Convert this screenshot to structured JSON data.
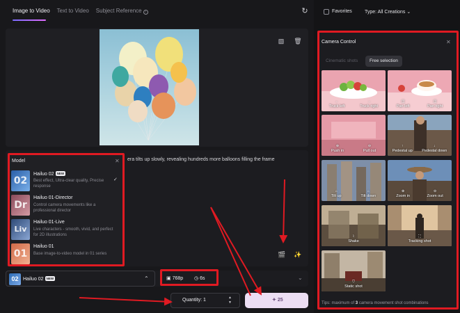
{
  "tabs": [
    {
      "label": "Image to Video"
    },
    {
      "label": "Text to Video"
    },
    {
      "label": "Subject Reference"
    }
  ],
  "refresh_icon": "refresh-icon",
  "prompt": {
    "text": "era tilts up slowly, revealing hundreds more balloons filling the frame"
  },
  "model_popup": {
    "title": "Model",
    "items": [
      {
        "name": "Hailuo 02",
        "badge": "NEW",
        "desc": "Best effect, Ultra-clear quality, Precise response",
        "thumb": "02",
        "color": "#3a7fd0",
        "selected": true
      },
      {
        "name": "Hailuo 01-Director",
        "desc": "Control camera movements like a professional director",
        "thumb": "Dr",
        "color": "#b66f7d"
      },
      {
        "name": "Hailuo 01-Live",
        "desc": "Live characters - smooth, vivid, and perfect for 2D illustrations",
        "thumb": "Liv",
        "color": "#4a6ea0"
      },
      {
        "name": "Hailuo 01",
        "desc": "Base image-to-video model in 01 series",
        "thumb": "01",
        "color": "#e0886a"
      }
    ]
  },
  "bottom": {
    "model_label": "Hailuo 02",
    "model_badge": "NEW",
    "model_thumb": "02",
    "resolution": "768p",
    "duration": "6s",
    "quantity_label": "Quantity: 1",
    "generate_label": "25"
  },
  "right": {
    "favorites_label": "Favorites",
    "type_label": "Type:  All Creations"
  },
  "camera_control": {
    "title": "Camera Control",
    "tabs": [
      "Cinematic shots",
      "Free selection"
    ],
    "shots": [
      {
        "labels": [
          "Truck left",
          "Truck right"
        ],
        "icons": [
          "←",
          "→"
        ],
        "bg": "linear-gradient(180deg,#e8a4b0 0%,#f2b9c2 55%,#d98d9a 100%)"
      },
      {
        "labels": [
          "Pan left",
          "Pan right"
        ],
        "icons": [
          "◫",
          "◫"
        ],
        "bg": "linear-gradient(180deg,#eaa6b2 0%,#f4c1c8 55%,#dc8e9b 100%)"
      },
      {
        "labels": [
          "Push in",
          "Pull out"
        ],
        "icons": [
          "⊕",
          "⊖"
        ],
        "bg": "linear-gradient(180deg,#e59aa7 0%,#efb2bb 60%,#c97a87 100%)"
      },
      {
        "labels": [
          "Pedestal up",
          "Pedestal down"
        ],
        "icons": [
          "↑",
          "↓"
        ],
        "bg": "linear-gradient(180deg,#8aa4bd 0%,#7c6a5a 50%,#3d3028 100%)"
      },
      {
        "labels": [
          "Tilt up",
          "Tilt down"
        ],
        "icons": [
          "⌂",
          "⌂"
        ],
        "bg": "linear-gradient(180deg,#7e8fa8 0%,#9a8f84 45%,#4f4a46 100%)"
      },
      {
        "labels": [
          "Zoom in",
          "Zoom out"
        ],
        "icons": [
          "⊕",
          "⊖"
        ],
        "bg": "linear-gradient(180deg,#6d8fb8 0%,#7a6a58 50%,#3e2f24 100%)"
      },
      {
        "labels": [
          "Shake"
        ],
        "icons": [
          "⌇"
        ],
        "bg": "linear-gradient(180deg,#c9b9a0 0%,#8a7a64 50%,#4c4034 100%)"
      },
      {
        "labels": [
          "Tracking shot"
        ],
        "icons": [
          "⛶"
        ],
        "bg": "linear-gradient(180deg,#e3c9a4 0%,#a98e70 50%,#5a4a3c 100%)"
      },
      {
        "labels": [
          "Static shot"
        ],
        "icons": [
          "⛉"
        ],
        "bg": "linear-gradient(180deg,#bfb3a3 0%,#8f7f6a 50%,#4a3e33 100%)"
      }
    ],
    "tips_prefix": "Tips:  maximum of",
    "tips_count": "3",
    "tips_suffix": "camera movement shot combinations"
  }
}
